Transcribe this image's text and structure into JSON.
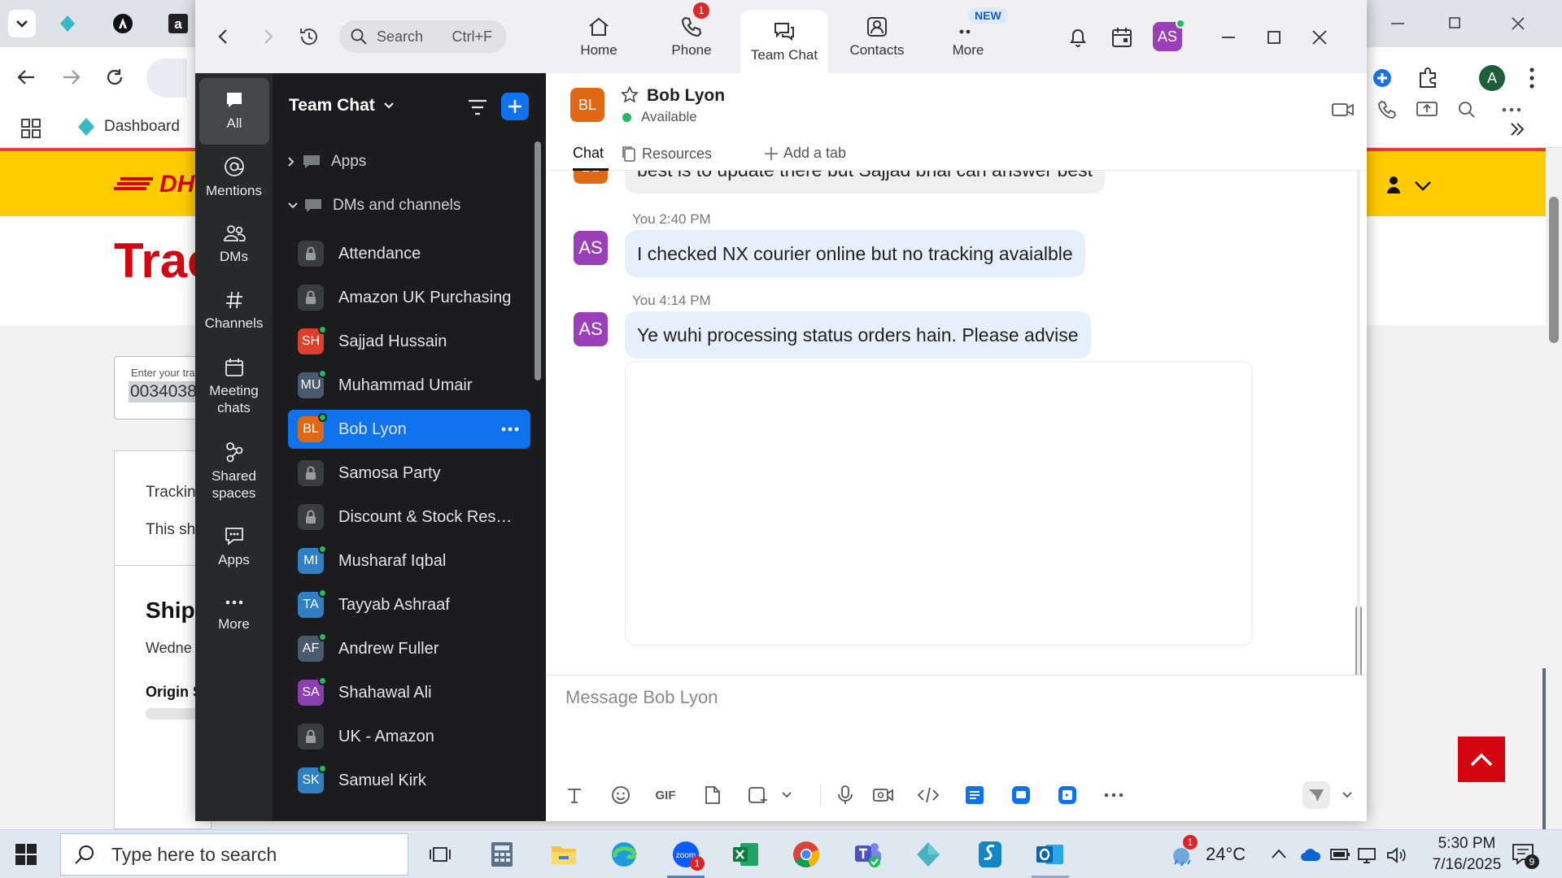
{
  "browser": {
    "bookmark": "Dashboard",
    "page_title_partial": "Trac",
    "field_hint": "Enter your tra",
    "field_value": "0034038",
    "line1": "Trackin",
    "line2": "This shi",
    "heading": "Shipr",
    "date_partial": "Wedne",
    "origin": "Origin S",
    "profile_initial": "A"
  },
  "zoom": {
    "search": {
      "placeholder": "Search",
      "shortcut": "Ctrl+F"
    },
    "nav": [
      {
        "label": "Home",
        "badge": ""
      },
      {
        "label": "Phone",
        "badge": "1"
      },
      {
        "label": "Team Chat",
        "badge": ""
      },
      {
        "label": "Contacts",
        "badge": ""
      },
      {
        "label": "More",
        "badge": "NEW"
      }
    ],
    "user_initials": "AS",
    "rail": [
      {
        "label": "All",
        "icon": "chat-bubble-icon"
      },
      {
        "label": "Mentions",
        "icon": "at-icon"
      },
      {
        "label": "DMs",
        "icon": "people-icon"
      },
      {
        "label": "Channels",
        "icon": "hash-icon"
      },
      {
        "label": "Meeting chats",
        "icon": "calendar-icon"
      },
      {
        "label": "Shared spaces",
        "icon": "shared-icon"
      },
      {
        "label": "Apps",
        "icon": "apps-icon"
      },
      {
        "label": "More",
        "icon": "more-icon"
      }
    ],
    "list_title": "Team Chat",
    "sections": {
      "apps": "Apps",
      "dms": "DMs and channels"
    },
    "channels": [
      {
        "name": "Attendance",
        "initials": "",
        "color": "",
        "lock": true,
        "presence": false
      },
      {
        "name": "Amazon UK Purchasing",
        "initials": "",
        "color": "",
        "lock": true,
        "presence": false
      },
      {
        "name": "Sajjad Hussain",
        "initials": "SH",
        "color": "#d9412c",
        "lock": false,
        "presence": true
      },
      {
        "name": "Muhammad Umair",
        "initials": "MU",
        "color": "#4a5a6e",
        "lock": false,
        "presence": true
      },
      {
        "name": "Bob Lyon",
        "initials": "BL",
        "color": "#e06812",
        "lock": false,
        "presence": true,
        "selected": true
      },
      {
        "name": "Samosa Party",
        "initials": "",
        "color": "",
        "lock": true,
        "presence": false
      },
      {
        "name": "Discount & Stock Reser...",
        "initials": "",
        "color": "",
        "lock": true,
        "presence": false
      },
      {
        "name": "Musharaf Iqbal",
        "initials": "MI",
        "color": "#2f7fc2",
        "lock": false,
        "presence": true
      },
      {
        "name": "Tayyab Ashraaf",
        "initials": "TA",
        "color": "#2f7fc2",
        "lock": false,
        "presence": true
      },
      {
        "name": "Andrew Fuller",
        "initials": "AF",
        "color": "#4a5a6e",
        "lock": false,
        "presence": true
      },
      {
        "name": "Shahawal Ali",
        "initials": "SA",
        "color": "#8a3fb0",
        "lock": false,
        "presence": true
      },
      {
        "name": "UK - Amazon",
        "initials": "",
        "color": "",
        "lock": true,
        "presence": false
      },
      {
        "name": "Samuel Kirk",
        "initials": "SK",
        "color": "#2f7fc2",
        "lock": false,
        "presence": true
      }
    ],
    "chat": {
      "contact": "Bob Lyon",
      "contact_initials": "BL",
      "status": "Available",
      "tabs": {
        "chat": "Chat",
        "resources": "Resources",
        "add": "Add a tab"
      },
      "messages": [
        {
          "sender": "BL",
          "meta": "",
          "text": "best is to update there but Sajjad bhai can answer best"
        },
        {
          "sender": "AS",
          "meta": "You 2:40 PM",
          "text": "I checked NX courier online but no tracking avaialble"
        },
        {
          "sender": "AS",
          "meta": "You 4:14 PM",
          "text": "Ye wuhi processing status orders hain. Please advise"
        }
      ],
      "compose_placeholder": "Message Bob Lyon"
    }
  },
  "taskbar": {
    "search_placeholder": "Type here to search",
    "weather": "24°C",
    "time": "5:30 PM",
    "date": "7/16/2025",
    "notification_count": "9",
    "weather_badge": "1",
    "zoom_badge": "1"
  },
  "colors": {
    "accent": "#0e72ed",
    "presence": "#1dbe5a",
    "dhl_yellow": "#ffcc00",
    "dhl_red": "#d40511"
  }
}
